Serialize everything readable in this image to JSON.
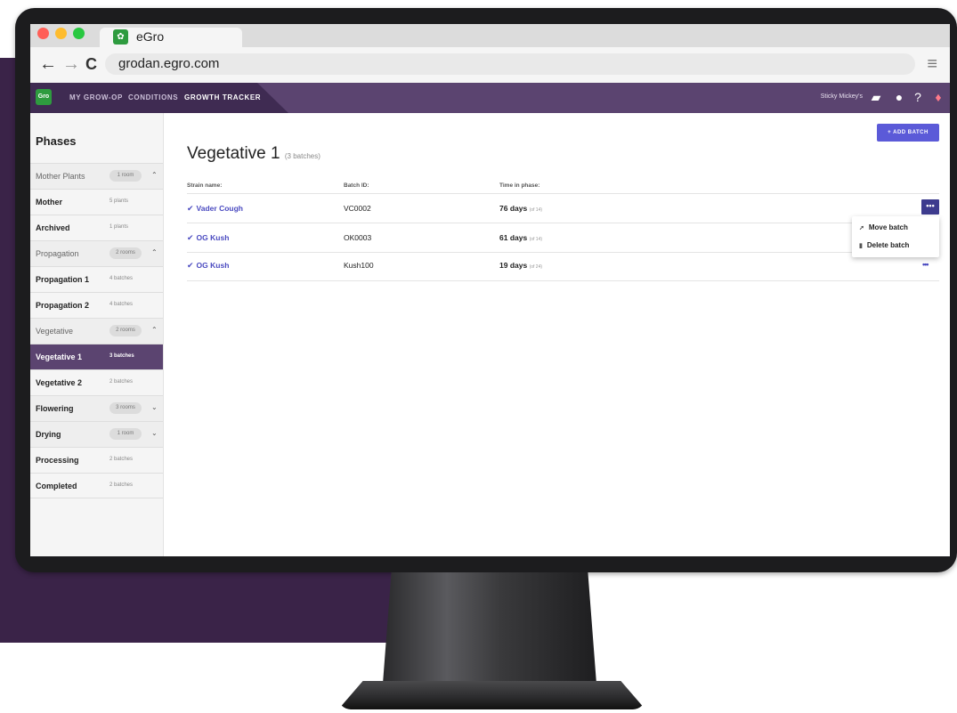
{
  "browser": {
    "tab_title": "eGro",
    "url": "grodan.egro.com"
  },
  "header": {
    "logo_text": "Gro",
    "nav": [
      "MY GROW-OP",
      "CONDITIONS",
      "GROWTH TRACKER"
    ],
    "active_nav": "GROWTH TRACKER",
    "org_name": "Sticky Mickey's"
  },
  "sidebar": {
    "title": "Phases",
    "rows": [
      {
        "label": "Mother Plants",
        "pill": "1 room",
        "type": "group",
        "chevron": "up"
      },
      {
        "label": "Mother",
        "count": "5 plants",
        "type": "item"
      },
      {
        "label": "Archived",
        "count": "1 plants",
        "type": "item"
      },
      {
        "label": "Propagation",
        "pill": "2 rooms",
        "type": "group",
        "chevron": "up"
      },
      {
        "label": "Propagation 1",
        "count": "4 batches",
        "type": "item"
      },
      {
        "label": "Propagation 2",
        "count": "4 batches",
        "type": "item"
      },
      {
        "label": "Vegetative",
        "pill": "2 rooms",
        "type": "group",
        "chevron": "up"
      },
      {
        "label": "Vegetative 1",
        "count": "3 batches",
        "type": "item",
        "active": true
      },
      {
        "label": "Vegetative 2",
        "count": "2 batches",
        "type": "item"
      },
      {
        "label": "Flowering",
        "pill": "3 rooms",
        "type": "group",
        "chevron": "down"
      },
      {
        "label": "Drying",
        "pill": "1 room",
        "type": "group",
        "chevron": "down"
      },
      {
        "label": "Processing",
        "count": "2 batches",
        "type": "item"
      },
      {
        "label": "Completed",
        "count": "2 batches",
        "type": "item"
      }
    ]
  },
  "main": {
    "title": "Vegetative 1",
    "subtitle": "(3 batches)",
    "add_button": "+ ADD BATCH",
    "columns": [
      "Strain name:",
      "Batch ID:",
      "Time in phase:"
    ],
    "rows": [
      {
        "strain": "Vader Cough",
        "batch_id": "VC0002",
        "days": "76 days",
        "of": "(of 14)"
      },
      {
        "strain": "OG Kush",
        "batch_id": "OK0003",
        "days": "61 days",
        "of": "(of 14)"
      },
      {
        "strain": "OG Kush",
        "batch_id": "Kush100",
        "days": "19 days",
        "of": "(of 24)"
      }
    ],
    "dropdown": [
      "Move batch",
      "Delete batch"
    ]
  },
  "colors": {
    "header_purple": "#5b4470",
    "accent_blue": "#5b5ad8",
    "brand_green": "#2e9b3f"
  }
}
